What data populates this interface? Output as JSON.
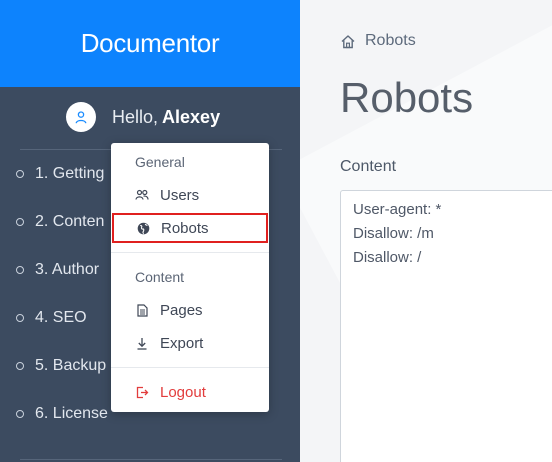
{
  "sidebar": {
    "brand": "Documentor",
    "greeting": "Hello,",
    "username": "Alexey",
    "nav": [
      {
        "label": "1. Getting"
      },
      {
        "label": "2. Conten"
      },
      {
        "label": "3. Author"
      },
      {
        "label": "4. SEO"
      },
      {
        "label": "5. Backup"
      },
      {
        "label": "6. License"
      }
    ]
  },
  "main": {
    "breadcrumb": "Robots",
    "title": "Robots",
    "content_label": "Content",
    "content_value": "User-agent: *\nDisallow: /m\nDisallow: /"
  },
  "dropdown": {
    "general_header": "General",
    "users": "Users",
    "robots": "Robots",
    "content_header": "Content",
    "pages": "Pages",
    "export": "Export",
    "logout": "Logout"
  },
  "colors": {
    "brand_blue": "#0d83fd",
    "sidebar": "#3c4b60",
    "highlight_outline": "#e0201f",
    "logout": "#e23c3c"
  }
}
